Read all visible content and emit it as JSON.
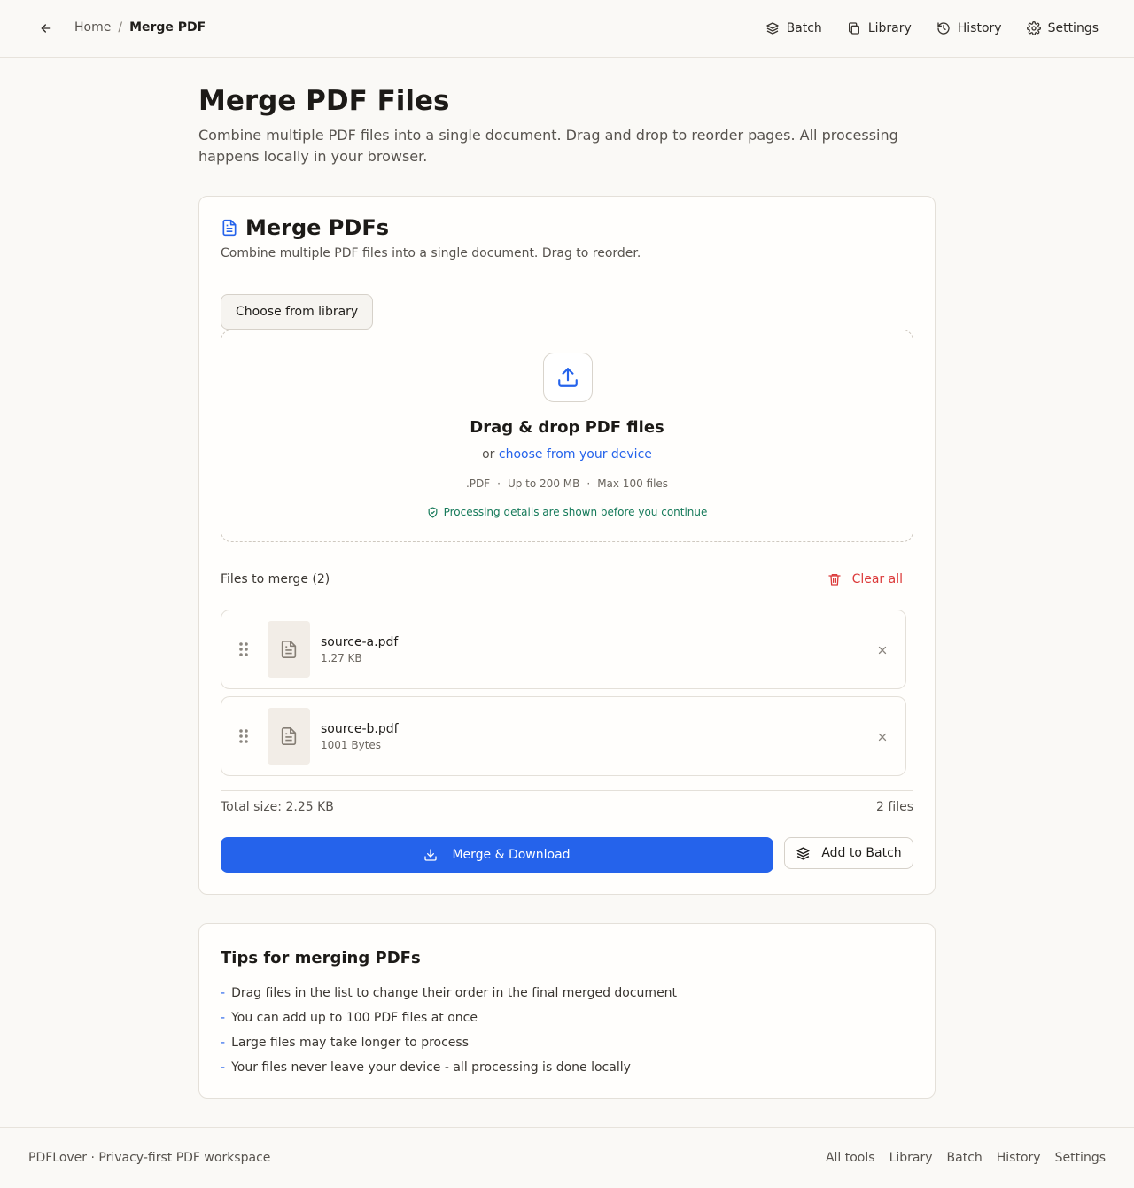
{
  "header": {
    "breadcrumb": {
      "home": "Home",
      "separator": "/",
      "current": "Merge PDF"
    },
    "nav": [
      {
        "label": "Batch",
        "icon": "layers-icon"
      },
      {
        "label": "Library",
        "icon": "copy-icon"
      },
      {
        "label": "History",
        "icon": "history-icon"
      },
      {
        "label": "Settings",
        "icon": "gear-icon"
      }
    ]
  },
  "page": {
    "title": "Merge PDF Files",
    "description": "Combine multiple PDF files into a single document. Drag and drop to reorder pages. All processing happens locally in your browser."
  },
  "card": {
    "title": "Merge PDFs",
    "subtitle": "Combine multiple PDF files into a single document. Drag to reorder.",
    "library_button": "Choose from library",
    "dropzone": {
      "title": "Drag & drop PDF files",
      "or_text": "or",
      "link_text": "choose from your device",
      "meta": [
        ".PDF",
        "Up to 200 MB",
        "Max 100 files"
      ],
      "meta_separator": "·",
      "privacy_note": "Processing details are shown before you continue"
    },
    "files_label": "Files to merge (2)",
    "clear_all": "Clear all",
    "files": [
      {
        "name": "source-a.pdf",
        "size": "1.27 KB"
      },
      {
        "name": "source-b.pdf",
        "size": "1001 Bytes"
      }
    ],
    "total_size": "Total size: 2.25 KB",
    "file_count": "2 files",
    "merge_button": "Merge & Download",
    "batch_button": "Add to Batch"
  },
  "tips": {
    "title": "Tips for merging PDFs",
    "bullet": "-",
    "items": [
      "Drag files in the list to change their order in the final merged document",
      "You can add up to 100 PDF files at once",
      "Large files may take longer to process",
      "Your files never leave your device - all processing is done locally"
    ]
  },
  "footer": {
    "brand": "PDFLover · Privacy-first PDF workspace",
    "links": [
      "All tools",
      "Library",
      "Batch",
      "History",
      "Settings"
    ]
  },
  "colors": {
    "accent": "#2563eb",
    "danger": "#dc3b3b",
    "success": "#167a5a",
    "background": "#faf9f6"
  }
}
